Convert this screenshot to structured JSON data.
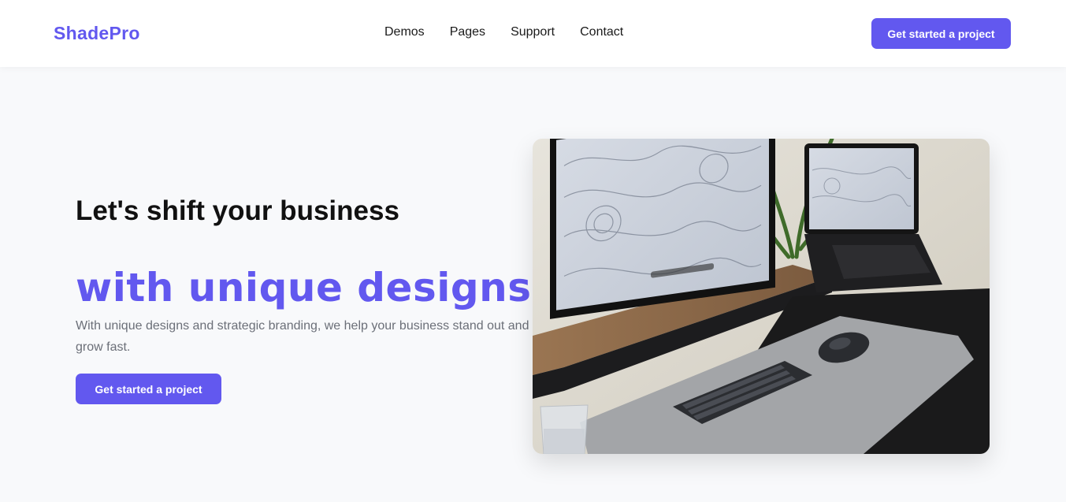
{
  "header": {
    "logo": "ShadePro",
    "nav": [
      "Demos",
      "Pages",
      "Support",
      "Contact"
    ],
    "cta_label": "Get started a project"
  },
  "hero": {
    "headline": "Let's shift your business",
    "headline_accent": "with unique designs.",
    "description": "With unique designs and strategic branding, we help your business stand out and grow fast.",
    "cta_label": "Get started a project",
    "image_alt": "Desk setup with monitor, laptop, keyboard and mouse"
  },
  "colors": {
    "accent": "#6258ef",
    "page_bg": "#f8f9fb",
    "header_bg": "#ffffff",
    "body_text": "#6b6f78"
  }
}
